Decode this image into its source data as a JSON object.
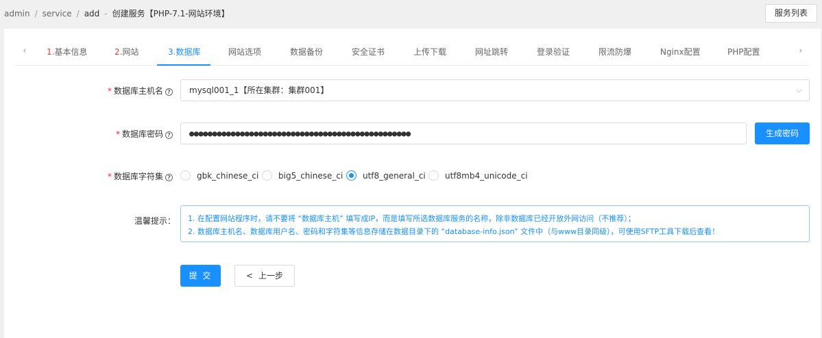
{
  "breadcrumb": {
    "items": [
      "admin",
      "service",
      "add"
    ],
    "current": "创建服务【PHP-7.1-网站环境】"
  },
  "header": {
    "list_button": "服务列表"
  },
  "tabs": [
    {
      "num": "1.",
      "label": "基本信息"
    },
    {
      "num": "2.",
      "label": "网站"
    },
    {
      "num": "3.",
      "label": "数据库"
    },
    {
      "num": "",
      "label": "网站选项"
    },
    {
      "num": "",
      "label": "数据备份"
    },
    {
      "num": "",
      "label": "安全证书"
    },
    {
      "num": "",
      "label": "上传下载"
    },
    {
      "num": "",
      "label": "网址跳转"
    },
    {
      "num": "",
      "label": "登录验证"
    },
    {
      "num": "",
      "label": "限流防爆"
    },
    {
      "num": "",
      "label": "Nginx配置"
    },
    {
      "num": "",
      "label": "PHP配置"
    }
  ],
  "active_tab": "数据库",
  "form": {
    "host_label": "数据库主机名",
    "host_value": "mysql001_1【所在集群：集群001】",
    "password_label": "数据库密码",
    "password_value": "●●●●●●●●●●●●●●●●●●●●●●●●●●●●●●●●●●●●●●●●●●●●●●●●",
    "generate_button": "生成密码",
    "charset_label": "数据库字符集",
    "charsets": [
      {
        "label": "gbk_chinese_ci",
        "checked": false
      },
      {
        "label": "big5_chinese_ci",
        "checked": false
      },
      {
        "label": "utf8_general_ci",
        "checked": true
      },
      {
        "label": "utf8mb4_unicode_ci",
        "checked": false
      }
    ],
    "tips_label": "温馨提示：",
    "tips": [
      "1. 在配置网站程序时，请不要将 “数据库主机” 填写成IP，而是填写所选数据库服务的名称，除非数据库已经开放外网访问（不推荐）；",
      "2. 数据库主机名、数据库用户名、密码和字符集等信息存储在数据目录下的 “database-info.json” 文件中（与www目录同级），可使用SFTP工具下载后查看！"
    ],
    "submit_button": "提 交",
    "prev_button": "上一步"
  },
  "colors": {
    "primary": "#1890ff",
    "required": "#f5222d",
    "tab_number": "#e4393c"
  }
}
